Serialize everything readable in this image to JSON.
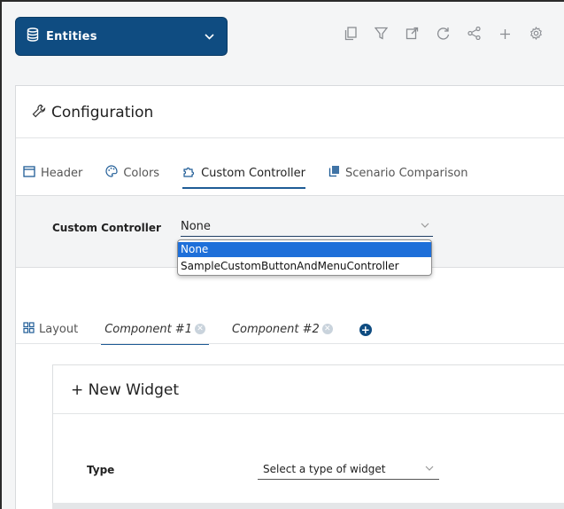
{
  "topbar": {
    "entities_label": "Entities",
    "entities_icon": "database-icon",
    "tools": [
      {
        "name": "copy-icon",
        "glyph": "⧉"
      },
      {
        "name": "filter-icon",
        "glyph": "▽"
      },
      {
        "name": "open-external-icon",
        "glyph": "⧉"
      },
      {
        "name": "refresh-icon",
        "glyph": "↻"
      },
      {
        "name": "share-icon",
        "glyph": "⋖"
      },
      {
        "name": "add-icon",
        "glyph": "+"
      },
      {
        "name": "settings-icon",
        "glyph": "⚙"
      }
    ]
  },
  "configuration": {
    "title": "Configuration",
    "tabs": [
      {
        "label": "Header",
        "icon": "window-icon"
      },
      {
        "label": "Colors",
        "icon": "palette-icon"
      },
      {
        "label": "Custom Controller",
        "icon": "puzzle-icon"
      },
      {
        "label": "Scenario Comparison",
        "icon": "copy-icon"
      }
    ],
    "custom_controller": {
      "label": "Custom Controller",
      "value": "None",
      "options": [
        "None",
        "SampleCustomButtonAndMenuController"
      ]
    }
  },
  "layout_tabs": {
    "layout_label": "Layout",
    "components": [
      "Component #1",
      "Component #2"
    ],
    "add_label": "+"
  },
  "widget": {
    "title": "+ New Widget",
    "type_label": "Type",
    "type_placeholder": "Select a type of widget"
  },
  "colors": {
    "accent": "#0f4c81",
    "selected": "#1e6fd9"
  }
}
